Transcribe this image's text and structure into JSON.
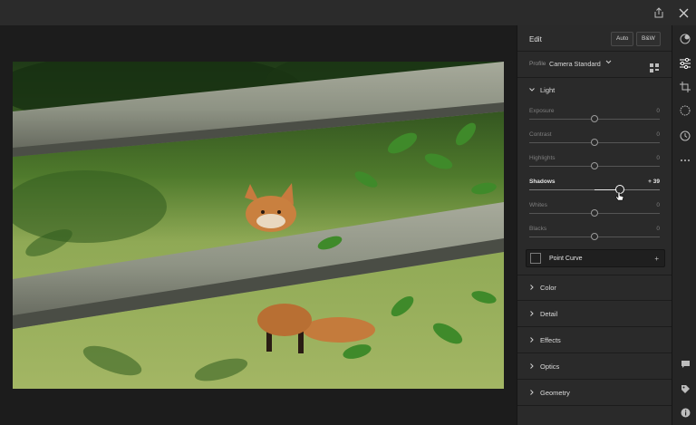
{
  "topbar": {
    "share_icon": "share-icon",
    "close_icon": "close-icon"
  },
  "panel": {
    "title": "Edit",
    "auto_label": "Auto",
    "bw_label": "B&W",
    "profile": {
      "label": "Profile",
      "value": "Camera Standard"
    },
    "light": {
      "label": "Light",
      "sliders": [
        {
          "label": "Exposure",
          "value": "0",
          "fraction": 0.5
        },
        {
          "label": "Contrast",
          "value": "0",
          "fraction": 0.5
        },
        {
          "label": "Highlights",
          "value": "0",
          "fraction": 0.5
        },
        {
          "label": "Shadows",
          "value": "+ 39",
          "fraction": 0.695
        },
        {
          "label": "Whites",
          "value": "0",
          "fraction": 0.5
        },
        {
          "label": "Blacks",
          "value": "0",
          "fraction": 0.5
        }
      ]
    },
    "point_curve": {
      "label": "Point Curve",
      "plus": "+"
    },
    "sections": [
      "Color",
      "Detail",
      "Effects",
      "Optics",
      "Geometry"
    ]
  },
  "tools": [
    "edit-presets-icon",
    "sliders-icon",
    "crop-icon",
    "healing-icon",
    "history-icon",
    "more-icon",
    "comment-icon",
    "tag-icon",
    "info-icon"
  ],
  "colors": {
    "panel_bg": "#2a2a2a",
    "active_text": "#e6e6e6"
  }
}
